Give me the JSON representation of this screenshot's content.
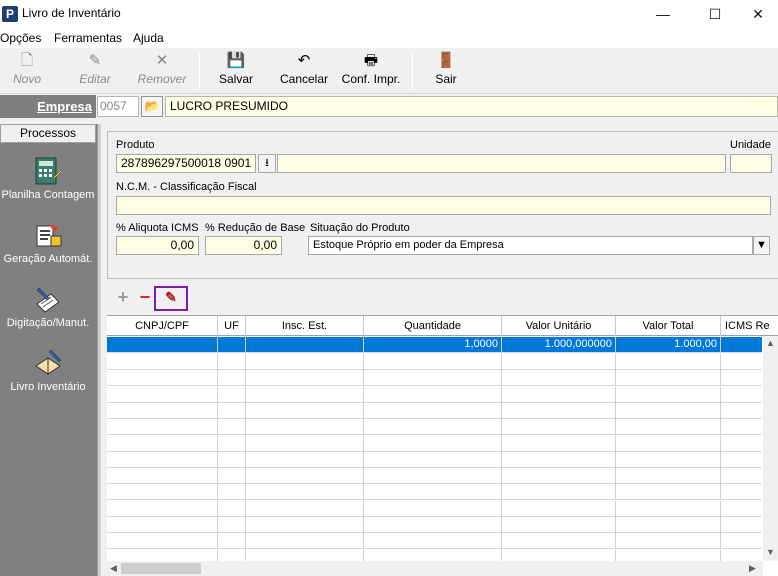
{
  "window": {
    "title": "Livro de Inventário",
    "app_icon_letter": "P",
    "minimize": "—",
    "maximize": "☐",
    "close": "✕"
  },
  "menu": {
    "items": [
      "Opções",
      "Ferramentas",
      "Ajuda"
    ]
  },
  "toolbar": {
    "novo": {
      "label": "Novo",
      "icon": "new-file-icon",
      "glyph": "🗋"
    },
    "editar": {
      "label": "Editar",
      "icon": "edit-icon",
      "glyph": "✎"
    },
    "remover": {
      "label": "Remover",
      "icon": "remove-icon",
      "glyph": "✕"
    },
    "salvar": {
      "label": "Salvar",
      "icon": "save-icon",
      "glyph": "💾"
    },
    "cancelar": {
      "label": "Cancelar",
      "icon": "undo-icon",
      "glyph": "↶"
    },
    "conf_impr": {
      "label": "Conf. Impr.",
      "icon": "printer-icon",
      "glyph": "🖶"
    },
    "sair": {
      "label": "Sair",
      "icon": "exit-door-icon",
      "glyph": "🚪"
    }
  },
  "empresa": {
    "label": "Empresa",
    "code": "0057",
    "name": "LUCRO PRESUMIDO"
  },
  "sidebar": {
    "header": "Processos",
    "items": [
      {
        "label": "Planilha Contagem",
        "icon": "spreadsheet-calculator-icon"
      },
      {
        "label": "Geração Automát.",
        "icon": "auto-generate-icon"
      },
      {
        "label": "Digitação/Manut.",
        "icon": "typing-edit-icon"
      },
      {
        "label": "Livro Inventário",
        "icon": "book-icon"
      }
    ]
  },
  "form": {
    "produto_label": "Produto",
    "produto_value": "287896297500018 0901",
    "produto_desc": "",
    "unidade_label": "Unidade",
    "unidade_value": "",
    "ncm_label": "N.C.M. - Classificação Fiscal",
    "ncm_value": "",
    "aliquota_label": "% Aliquota ICMS",
    "aliquota_value": "0,00",
    "reducao_label": "% Redução de Base",
    "reducao_value": "0,00",
    "situacao_label": "Situação do Produto",
    "situacao_value": "Estoque Próprio em poder da Empresa"
  },
  "grid_toolbar": {
    "add": "+",
    "remove": "−",
    "edit": "✎"
  },
  "grid": {
    "columns": [
      "CNPJ/CPF",
      "UF",
      "Insc. Est.",
      "Quantidade",
      "Valor Unitário",
      "Valor Total",
      "ICMS Re"
    ],
    "rows": [
      {
        "cnpj": "",
        "uf": "",
        "insc": "",
        "quantidade": "1,0000",
        "valor_unitario": "1.000,000000",
        "valor_total": "1.000,00",
        "icms": ""
      }
    ]
  },
  "colors": {
    "selection": "#0078d7",
    "field_bg": "#ffffe6",
    "sidebar_bg": "#808080",
    "highlight_border": "#7b1fa2"
  }
}
